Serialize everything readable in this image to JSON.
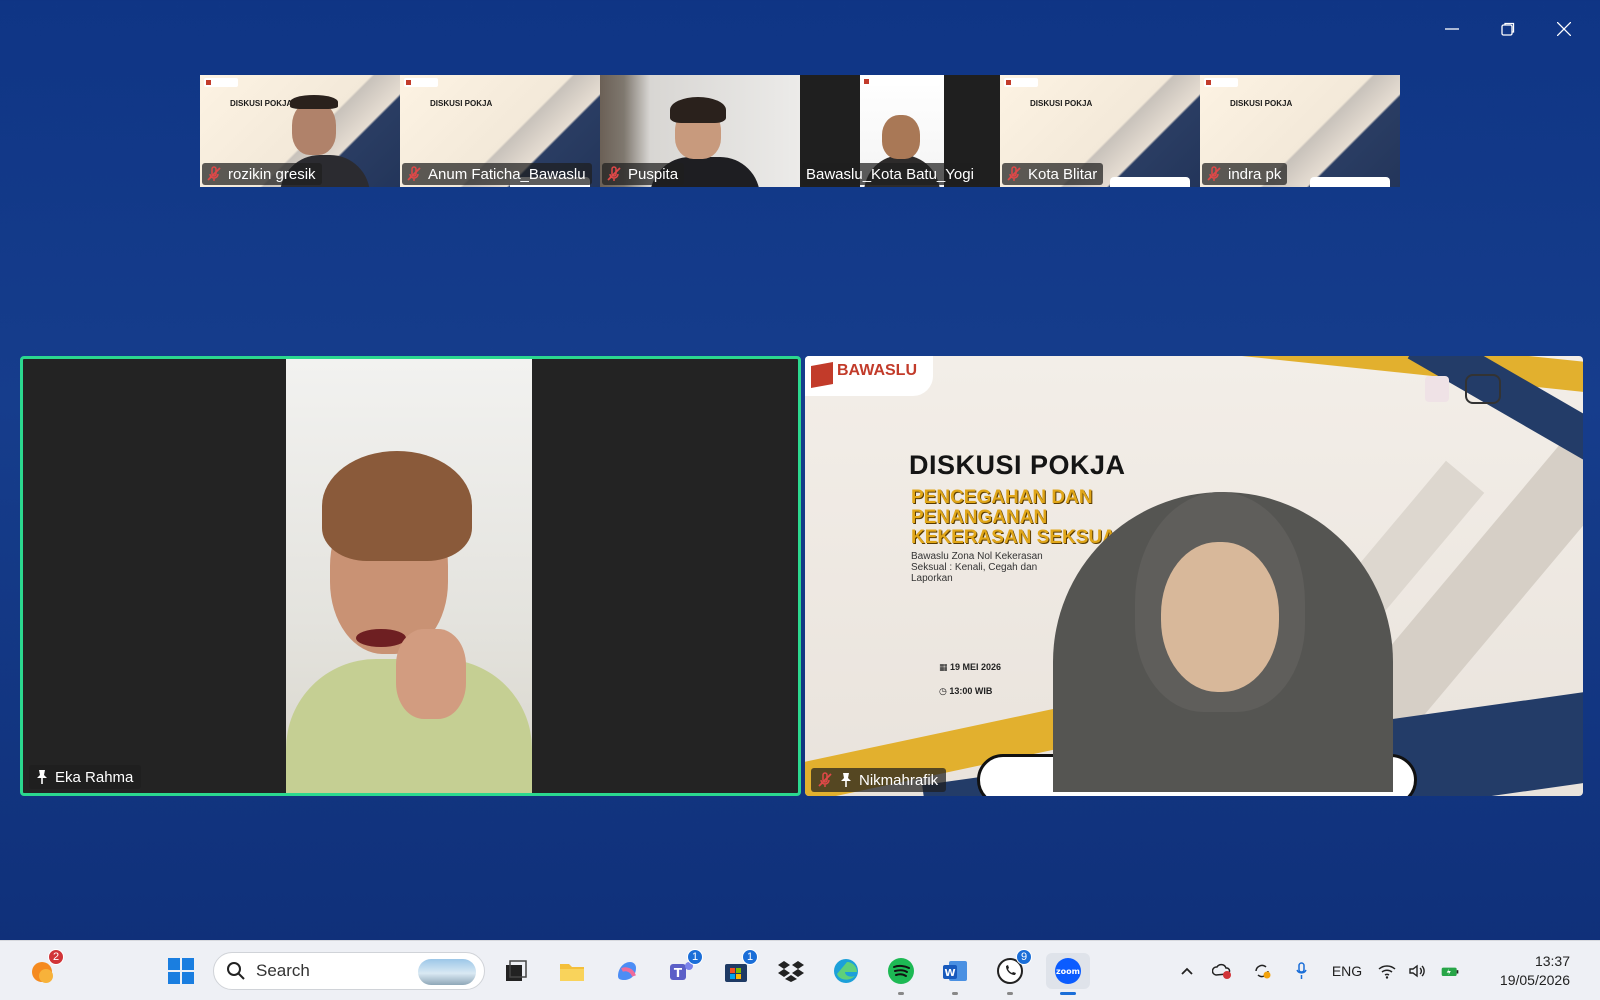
{
  "window": {
    "controls": [
      "minimize",
      "restore",
      "close"
    ]
  },
  "thumbnails": [
    {
      "name": "rozikin gresik",
      "muted": true,
      "kind": "slide-cam",
      "slide_title": "DISKUSI POKJA"
    },
    {
      "name": "Anum Faticha_Bawaslu",
      "muted": true,
      "kind": "slide",
      "slide_title": "DISKUSI POKJA"
    },
    {
      "name": "Puspita",
      "muted": true,
      "kind": "camera"
    },
    {
      "name": "Bawaslu_Kota Batu_Yogi",
      "muted": false,
      "kind": "phone"
    },
    {
      "name": "Kota Blitar",
      "muted": true,
      "kind": "slide",
      "slide_title": "DISKUSI POKJA"
    },
    {
      "name": "indra pk",
      "muted": true,
      "kind": "slide",
      "slide_title": "DISKUSI POKJA"
    }
  ],
  "main_tiles": {
    "left": {
      "name": "Eka Rahma",
      "pinned": true,
      "speaking": true,
      "highlight_color": "#2bd88f"
    },
    "right": {
      "name": "Nikmahrafik",
      "pinned": true,
      "muted": true,
      "slide": {
        "logo_text": "BAWASLU",
        "title": "DISKUSI POKJA",
        "subtitle_lines": [
          "PENCEGAHAN DAN",
          "PENANGANAN",
          "KEKERASAN SEKSUAL"
        ],
        "description": "Bawaslu Zona Nol Kekerasan Seksual : Kenali, Cegah dan Laporkan",
        "date": "19 MEI 2026",
        "time": "13:00 WIB"
      }
    }
  },
  "taskbar": {
    "search_placeholder": "Search",
    "weather_badge": "2",
    "teams_badge": "1",
    "store_badge": "1",
    "whatsapp_badge": "9",
    "zoom_label": "zoom",
    "language": "ENG",
    "time": "13:37",
    "date": "19/05/2026"
  },
  "colors": {
    "background": "#163d8c",
    "speaking_border": "#2bd88f",
    "slide_gold": "#e2b02e",
    "slide_navy": "#233c68"
  }
}
